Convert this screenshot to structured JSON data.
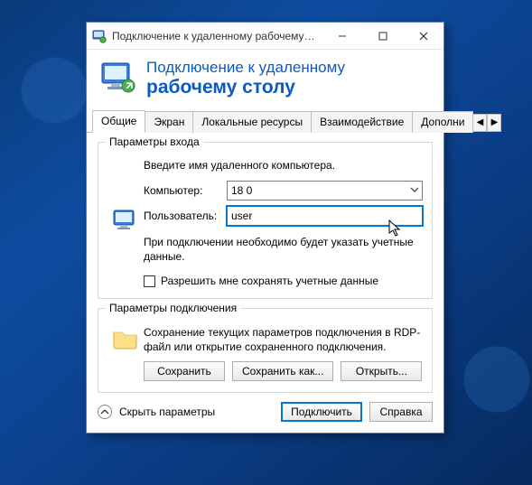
{
  "window": {
    "title": "Подключение к удаленному рабочему с..."
  },
  "banner": {
    "line1": "Подключение к удаленному",
    "line2": "рабочему столу"
  },
  "tabs": {
    "items": [
      "Общие",
      "Экран",
      "Локальные ресурсы",
      "Взаимодействие",
      "Дополни"
    ],
    "active_index": 0
  },
  "login_group": {
    "legend": "Параметры входа",
    "prompt": "Введите имя удаленного компьютера.",
    "computer_label": "Компьютер:",
    "computer_value": "18             0",
    "user_label": "Пользователь:",
    "user_value": "user",
    "note": "При подключении необходимо будет указать учетные данные.",
    "save_creds_label": "Разрешить мне сохранять учетные данные",
    "save_creds_checked": false
  },
  "conn_group": {
    "legend": "Параметры подключения",
    "desc": "Сохранение текущих параметров подключения в RDP-файл или открытие сохраненного подключения.",
    "save": "Сохранить",
    "save_as": "Сохранить как...",
    "open": "Открыть..."
  },
  "footer": {
    "disclose_label": "Скрыть параметры",
    "connect": "Подключить",
    "help": "Справка"
  }
}
